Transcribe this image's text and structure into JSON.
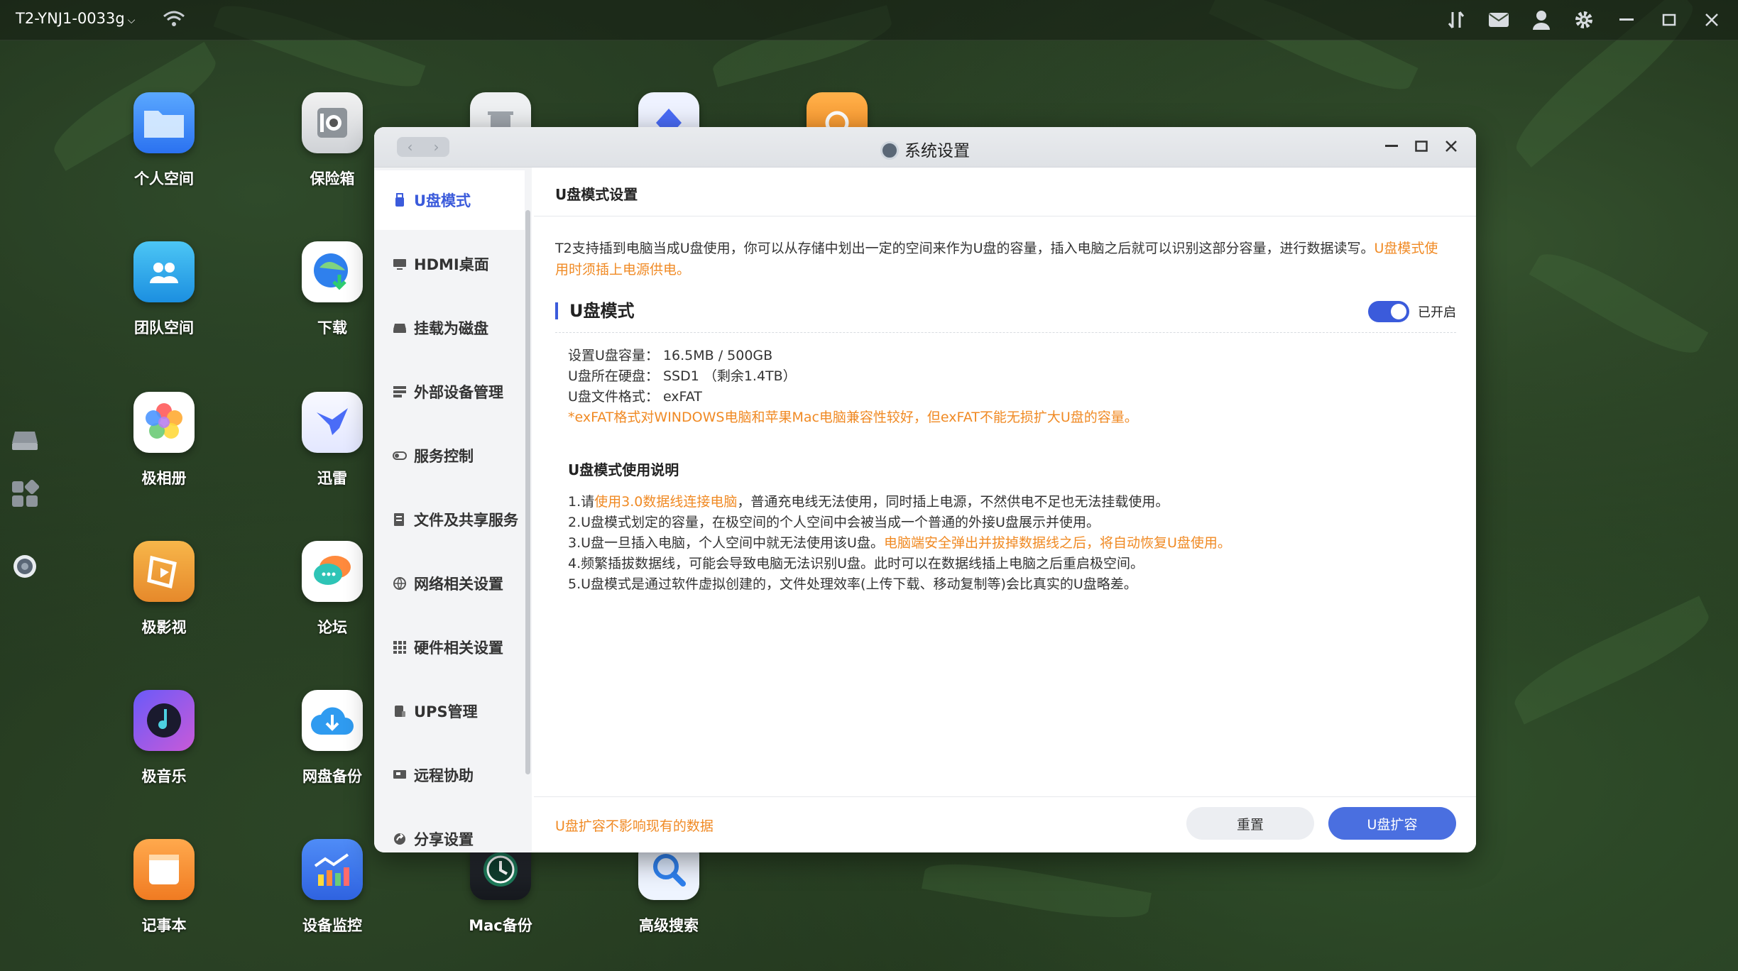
{
  "topbar": {
    "device_name": "T2-YNJ1-0033g"
  },
  "desktop": {
    "icons": [
      {
        "label": "个人空间"
      },
      {
        "label": "保险箱"
      },
      {
        "label": "团队空间"
      },
      {
        "label": "下载"
      },
      {
        "label": "极相册"
      },
      {
        "label": "迅雷"
      },
      {
        "label": "极影视"
      },
      {
        "label": "论坛"
      },
      {
        "label": "极音乐"
      },
      {
        "label": "网盘备份"
      },
      {
        "label": "记事本"
      },
      {
        "label": "设备监控"
      },
      {
        "label": "Mac备份"
      },
      {
        "label": "高级搜索"
      }
    ]
  },
  "window": {
    "title": "系统设置",
    "sidebar": {
      "items": [
        {
          "label": "U盘模式"
        },
        {
          "label": "HDMI桌面"
        },
        {
          "label": "挂载为磁盘"
        },
        {
          "label": "外部设备管理"
        },
        {
          "label": "服务控制"
        },
        {
          "label": "文件及共享服务"
        },
        {
          "label": "网络相关设置"
        },
        {
          "label": "硬件相关设置"
        },
        {
          "label": "UPS管理"
        },
        {
          "label": "远程协助"
        },
        {
          "label": "分享设置"
        }
      ]
    },
    "content": {
      "header": "U盘模式设置",
      "desc_text": "T2支持插到电脑当成U盘使用，你可以从存储中划出一定的空间来作为U盘的容量，插入电脑之后就可以识别这部分容量，进行数据读写。",
      "desc_warning": "U盘模式使用时须插上电源供电。",
      "section_title": "U盘模式",
      "toggle_label": "已开启",
      "info": {
        "capacity": "设置U盘容量：  16.5MB / 500GB",
        "disk": "U盘所在硬盘：  SSD1  （剩余1.4TB）",
        "format": "U盘文件格式：  exFAT",
        "note": "*exFAT格式对WINDOWS电脑和苹果Mac电脑兼容性较好，但exFAT不能无损扩大U盘的容量。"
      },
      "usage_title": "U盘模式使用说明",
      "usage": {
        "l1_a": "1.请",
        "l1_b": "使用3.0数据线连接电脑",
        "l1_c": "，普通充电线无法使用，同时插上电源，不然供电不足也无法挂载使用。",
        "l2": "2.U盘模式划定的容量，在极空间的个人空间中会被当成一个普通的外接U盘展示并使用。",
        "l3_a": "3.U盘一旦插入电脑，个人空间中就无法使用该U盘。",
        "l3_b": "电脑端安全弹出并拔掉数据线之后，将自动恢复U盘使用。",
        "l4": "4.频繁插拔数据线，可能会导致电脑无法识别U盘。此时可以在数据线插上电脑之后重启极空间。",
        "l5": "5.U盘模式是通过软件虚拟创建的，文件处理效率(上传下载、移动复制等)会比真实的U盘略差。"
      },
      "footer": {
        "note": "U盘扩容不影响现有的数据",
        "reset_label": "重置",
        "expand_label": "U盘扩容"
      }
    }
  },
  "colors": {
    "accent": "#3b5bdb",
    "warning": "#f08a24"
  }
}
